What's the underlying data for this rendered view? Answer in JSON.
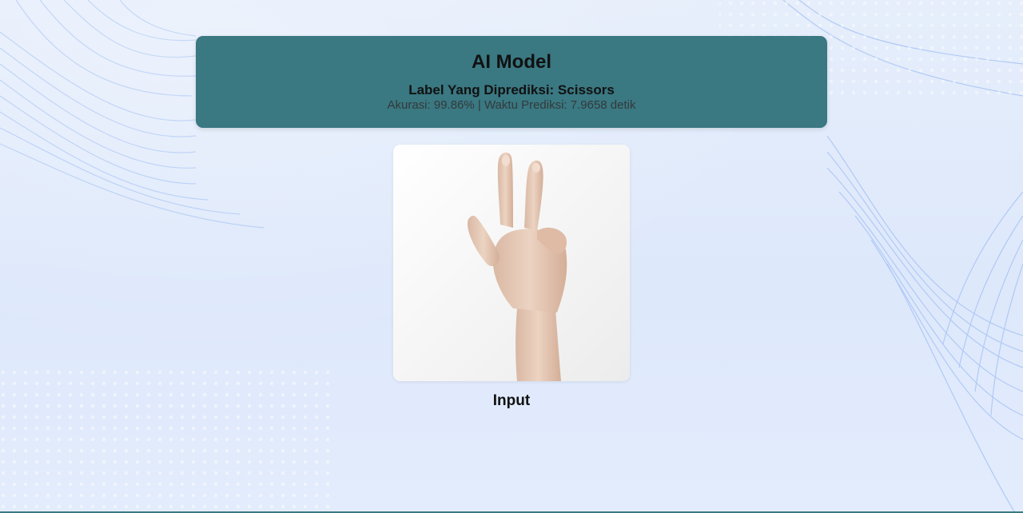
{
  "header": {
    "title": "AI Model",
    "predicted_label_text": "Label Yang Diprediksi: Scissors",
    "metrics_text": "Akurasi: 99.86% | Waktu Prediksi: 7.9658 detik"
  },
  "input_image": {
    "subject": "hand showing scissors gesture",
    "caption": "Input"
  },
  "colors": {
    "header_background": "#3a7882",
    "page_background": "#e3ecfc",
    "background_pattern": "#a9c4f4"
  }
}
